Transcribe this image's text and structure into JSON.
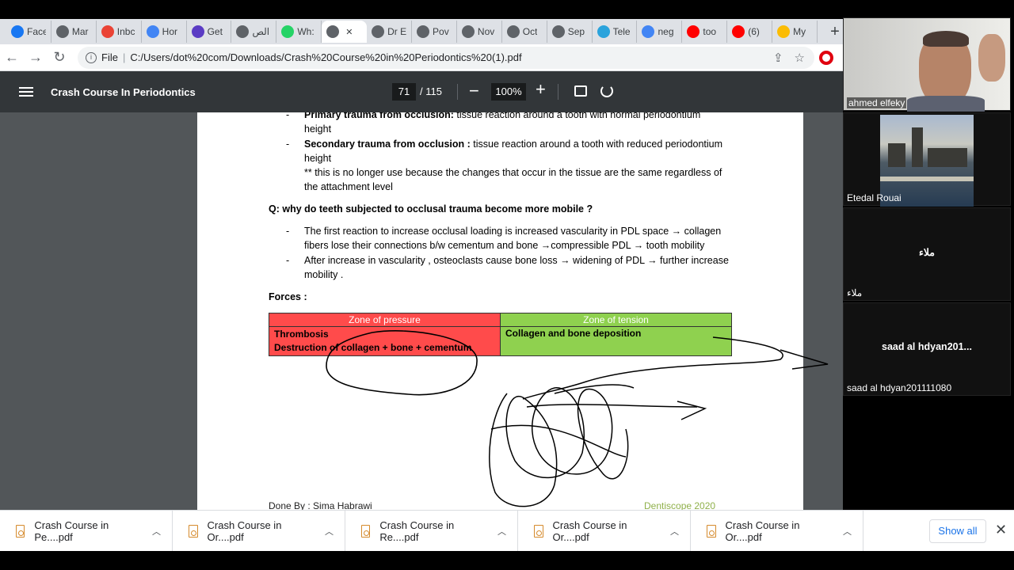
{
  "tabs": [
    {
      "label": "Face",
      "icon": "facebook-icon",
      "color": "#1877f2"
    },
    {
      "label": "Mar",
      "icon": "globe-icon",
      "color": "#5f6368"
    },
    {
      "label": "Inbc",
      "icon": "gmail-icon",
      "color": "#ea4335"
    },
    {
      "label": "Hor",
      "icon": "translate-icon",
      "color": "#4285f4"
    },
    {
      "label": "Get",
      "icon": "app-icon",
      "color": "#5b3cc4"
    },
    {
      "label": "الص",
      "icon": "globe-icon",
      "color": "#5f6368"
    },
    {
      "label": "Wh:",
      "icon": "whatsapp-icon",
      "color": "#25d366"
    },
    {
      "label": "",
      "icon": "globe-icon",
      "color": "#5f6368",
      "active": true
    },
    {
      "label": "Dr E",
      "icon": "globe-icon",
      "color": "#5f6368"
    },
    {
      "label": "Pov",
      "icon": "globe-icon",
      "color": "#5f6368"
    },
    {
      "label": "Nov",
      "icon": "globe-icon",
      "color": "#5f6368"
    },
    {
      "label": "Oct",
      "icon": "globe-icon",
      "color": "#5f6368"
    },
    {
      "label": "Sep",
      "icon": "globe-icon",
      "color": "#5f6368"
    },
    {
      "label": "Tele",
      "icon": "telegram-icon",
      "color": "#2aa3dc"
    },
    {
      "label": "neg",
      "icon": "google-icon",
      "color": "#4285f4"
    },
    {
      "label": "too",
      "icon": "youtube-icon",
      "color": "#ff0000"
    },
    {
      "label": "(6)",
      "icon": "youtube-icon",
      "color": "#ff0000"
    },
    {
      "label": "My",
      "icon": "drive-icon",
      "color": "#fbbc04"
    }
  ],
  "address": {
    "scheme": "File",
    "url": "C:/Users/dot%20com/Downloads/Crash%20Course%20in%20Periodontics%20(1).pdf"
  },
  "pdf": {
    "title": "Crash Course In Periodontics",
    "page": "71",
    "total": "/ 115",
    "zoom": "100%"
  },
  "content": {
    "b1_bold": "Primary trauma from occlusion:",
    "b1_rest": " tissue reaction around a tooth with normal periodontium",
    "b1_line2": "height",
    "b2_bold": "Secondary trauma from occlusion :",
    "b2_rest": " tissue reaction around a tooth with reduced periodontium",
    "b2_line2": "height",
    "b2_note1": "** this is no longer use because the changes that occur in the tissue are the same regardless of",
    "b2_note2": "the attachment level",
    "question": "Q: why do teeth subjected to occlusal trauma become more mobile ?",
    "a1_line1": "The first reaction to increase occlusal loading is increased vascularity in PDL space → collagen",
    "a1_line2": "fibers lose their connections b/w cementum and bone →compressible PDL →  tooth mobility",
    "a2_line1": "After increase in vascularity , osteoclasts cause bone loss → widening of PDL → further increase",
    "a2_line2": "mobility .",
    "forces": "Forces :",
    "zone_pressure": "Zone of pressure",
    "zone_tension": "Zone of tension",
    "pressure_1": "Thrombosis",
    "pressure_2": "Destruction of collagen + bone + cementum",
    "tension_1": "Collagen and bone deposition",
    "footer_left": "Done By : Sima Habrawi",
    "footer_right": "Dentiscope 2020",
    "bullet_char": "-"
  },
  "participants": [
    {
      "name": "ahmed elfeky",
      "video": "camera"
    },
    {
      "name": "Etedal Rouai",
      "video": "image"
    },
    {
      "name": "ملاء",
      "center": "ملاء"
    },
    {
      "name": "saad al hdyan201111080",
      "center": "saad al hdyan201..."
    }
  ],
  "downloads": [
    "Crash Course in Pe....pdf",
    "Crash Course in Or....pdf",
    "Crash Course in Re....pdf",
    "Crash Course in Or....pdf",
    "Crash Course in Or....pdf"
  ],
  "downloads_show_all": "Show all"
}
